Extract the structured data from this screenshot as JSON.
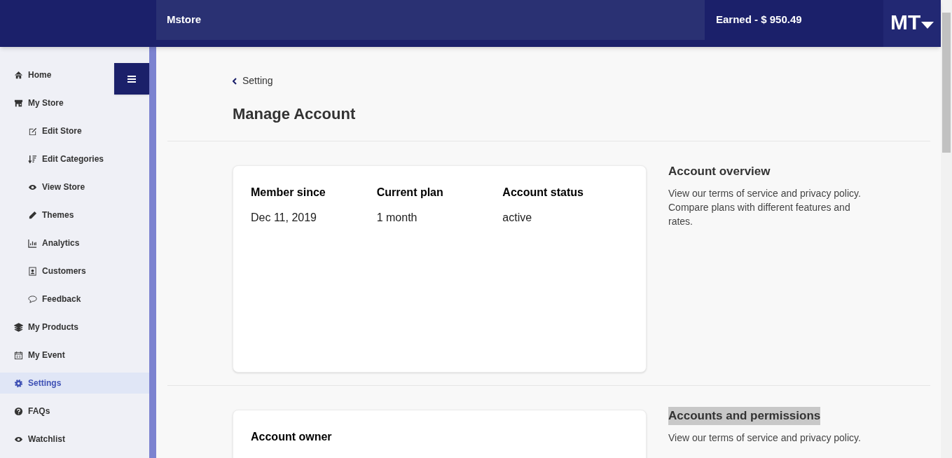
{
  "header": {
    "brand": "Mstore",
    "earned": "Earned - $ 950.49",
    "user_initials": "MT"
  },
  "sidebar": {
    "items": [
      {
        "label": "Home",
        "selected": false
      },
      {
        "label": "My Store",
        "selected": false,
        "children": [
          {
            "label": "Edit Store",
            "selected": false
          },
          {
            "label": "Edit Categories",
            "selected": false
          },
          {
            "label": "View Store",
            "selected": false
          },
          {
            "label": "Themes",
            "selected": false
          },
          {
            "label": "Analytics",
            "selected": false
          },
          {
            "label": "Customers",
            "selected": false
          },
          {
            "label": "Feedback",
            "selected": false
          }
        ]
      },
      {
        "label": "My Products",
        "selected": false
      },
      {
        "label": "My Event",
        "selected": false
      },
      {
        "label": "Settings",
        "selected": true
      },
      {
        "label": "FAQs",
        "selected": false
      },
      {
        "label": "Watchlist",
        "selected": false
      }
    ]
  },
  "breadcrumb": "Setting",
  "page_title": "Manage Account",
  "sections": [
    {
      "card": {
        "fields": [
          {
            "label": "Member since",
            "value": "Dec 11, 2019"
          },
          {
            "label": "Current plan",
            "value": "1 month"
          },
          {
            "label": "Account status",
            "value": "active"
          }
        ]
      },
      "heading": "Account overview",
      "heading_highlighted": false,
      "description": "View our terms of service and privacy policy. Compare plans with different features and rates."
    },
    {
      "card": {
        "fields": [
          {
            "label": "Account owner"
          }
        ]
      },
      "heading": "Accounts and permissions",
      "heading_highlighted": true,
      "description": "View our terms of service and privacy policy."
    }
  ]
}
